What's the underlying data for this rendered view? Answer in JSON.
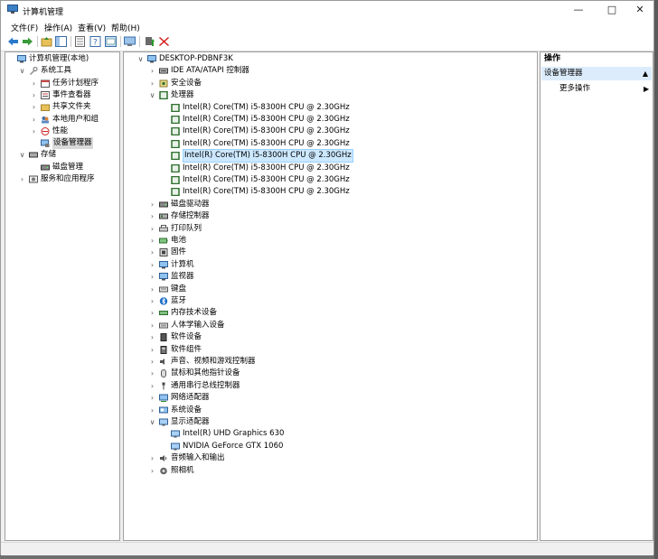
{
  "window": {
    "title": "计算机管理"
  },
  "menubar": [
    {
      "label": "文件(F)"
    },
    {
      "label": "操作(A)"
    },
    {
      "label": "查看(V)"
    },
    {
      "label": "帮助(H)"
    }
  ],
  "left_tree": [
    {
      "label": "计算机管理(本地)",
      "level": 0,
      "chevron": "",
      "icon": "computer-management-icon"
    },
    {
      "label": "系统工具",
      "level": 1,
      "chevron": "expanded",
      "icon": "tools-icon"
    },
    {
      "label": "任务计划程序",
      "level": 2,
      "chevron": "collapsed",
      "icon": "task-scheduler-icon"
    },
    {
      "label": "事件查看器",
      "level": 2,
      "chevron": "collapsed",
      "icon": "event-viewer-icon"
    },
    {
      "label": "共享文件夹",
      "level": 2,
      "chevron": "collapsed",
      "icon": "shared-folder-icon"
    },
    {
      "label": "本地用户和组",
      "level": 2,
      "chevron": "collapsed",
      "icon": "users-icon"
    },
    {
      "label": "性能",
      "level": 2,
      "chevron": "collapsed",
      "icon": "performance-icon"
    },
    {
      "label": "设备管理器",
      "level": 2,
      "chevron": "",
      "icon": "device-manager-icon",
      "selected": true
    },
    {
      "label": "存储",
      "level": 1,
      "chevron": "expanded",
      "icon": "storage-icon"
    },
    {
      "label": "磁盘管理",
      "level": 2,
      "chevron": "",
      "icon": "disk-management-icon"
    },
    {
      "label": "服务和应用程序",
      "level": 1,
      "chevron": "collapsed",
      "icon": "services-icon"
    }
  ],
  "device_tree": [
    {
      "label": "DESKTOP-PDBNF3K",
      "level": 0,
      "chevron": "expanded",
      "icon": "computer-icon"
    },
    {
      "label": "IDE ATA/ATAPI 控制器",
      "level": 1,
      "chevron": "collapsed",
      "icon": "ide-icon"
    },
    {
      "label": "安全设备",
      "level": 1,
      "chevron": "collapsed",
      "icon": "security-device-icon"
    },
    {
      "label": "处理器",
      "level": 1,
      "chevron": "expanded",
      "icon": "processor-icon"
    },
    {
      "label": "Intel(R) Core(TM) i5-8300H CPU @ 2.30GHz",
      "level": 2,
      "chevron": "",
      "icon": "cpu-icon"
    },
    {
      "label": "Intel(R) Core(TM) i5-8300H CPU @ 2.30GHz",
      "level": 2,
      "chevron": "",
      "icon": "cpu-icon"
    },
    {
      "label": "Intel(R) Core(TM) i5-8300H CPU @ 2.30GHz",
      "level": 2,
      "chevron": "",
      "icon": "cpu-icon"
    },
    {
      "label": "Intel(R) Core(TM) i5-8300H CPU @ 2.30GHz",
      "level": 2,
      "chevron": "",
      "icon": "cpu-icon"
    },
    {
      "label": "Intel(R) Core(TM) i5-8300H CPU @ 2.30GHz",
      "level": 2,
      "chevron": "",
      "icon": "cpu-icon",
      "selected": true
    },
    {
      "label": "Intel(R) Core(TM) i5-8300H CPU @ 2.30GHz",
      "level": 2,
      "chevron": "",
      "icon": "cpu-icon"
    },
    {
      "label": "Intel(R) Core(TM) i5-8300H CPU @ 2.30GHz",
      "level": 2,
      "chevron": "",
      "icon": "cpu-icon"
    },
    {
      "label": "Intel(R) Core(TM) i5-8300H CPU @ 2.30GHz",
      "level": 2,
      "chevron": "",
      "icon": "cpu-icon"
    },
    {
      "label": "磁盘驱动器",
      "level": 1,
      "chevron": "collapsed",
      "icon": "disk-drive-icon"
    },
    {
      "label": "存储控制器",
      "level": 1,
      "chevron": "collapsed",
      "icon": "storage-controller-icon"
    },
    {
      "label": "打印队列",
      "level": 1,
      "chevron": "collapsed",
      "icon": "printer-icon"
    },
    {
      "label": "电池",
      "level": 1,
      "chevron": "collapsed",
      "icon": "battery-icon"
    },
    {
      "label": "固件",
      "level": 1,
      "chevron": "collapsed",
      "icon": "firmware-icon"
    },
    {
      "label": "计算机",
      "level": 1,
      "chevron": "collapsed",
      "icon": "computer-icon"
    },
    {
      "label": "监视器",
      "level": 1,
      "chevron": "collapsed",
      "icon": "monitor-icon"
    },
    {
      "label": "键盘",
      "level": 1,
      "chevron": "collapsed",
      "icon": "keyboard-icon"
    },
    {
      "label": "蓝牙",
      "level": 1,
      "chevron": "collapsed",
      "icon": "bluetooth-icon"
    },
    {
      "label": "内存技术设备",
      "level": 1,
      "chevron": "collapsed",
      "icon": "memory-device-icon"
    },
    {
      "label": "人体学输入设备",
      "level": 1,
      "chevron": "collapsed",
      "icon": "hid-icon"
    },
    {
      "label": "软件设备",
      "level": 1,
      "chevron": "collapsed",
      "icon": "software-device-icon"
    },
    {
      "label": "软件组件",
      "level": 1,
      "chevron": "collapsed",
      "icon": "software-component-icon"
    },
    {
      "label": "声音、视频和游戏控制器",
      "level": 1,
      "chevron": "collapsed",
      "icon": "sound-icon"
    },
    {
      "label": "鼠标和其他指针设备",
      "level": 1,
      "chevron": "collapsed",
      "icon": "mouse-icon"
    },
    {
      "label": "通用串行总线控制器",
      "level": 1,
      "chevron": "collapsed",
      "icon": "usb-icon"
    },
    {
      "label": "网络适配器",
      "level": 1,
      "chevron": "collapsed",
      "icon": "network-adapter-icon"
    },
    {
      "label": "系统设备",
      "level": 1,
      "chevron": "collapsed",
      "icon": "system-device-icon"
    },
    {
      "label": "显示适配器",
      "level": 1,
      "chevron": "expanded",
      "icon": "display-adapter-icon"
    },
    {
      "label": "Intel(R) UHD Graphics 630",
      "level": 2,
      "chevron": "",
      "icon": "gpu-icon"
    },
    {
      "label": "NVIDIA GeForce GTX 1060",
      "level": 2,
      "chevron": "",
      "icon": "gpu-icon"
    },
    {
      "label": "音频输入和输出",
      "level": 1,
      "chevron": "collapsed",
      "icon": "audio-io-icon"
    },
    {
      "label": "照相机",
      "level": 1,
      "chevron": "collapsed",
      "icon": "camera-icon"
    }
  ],
  "actions": {
    "header": "操作",
    "section": "设备管理器",
    "more": "更多操作"
  }
}
